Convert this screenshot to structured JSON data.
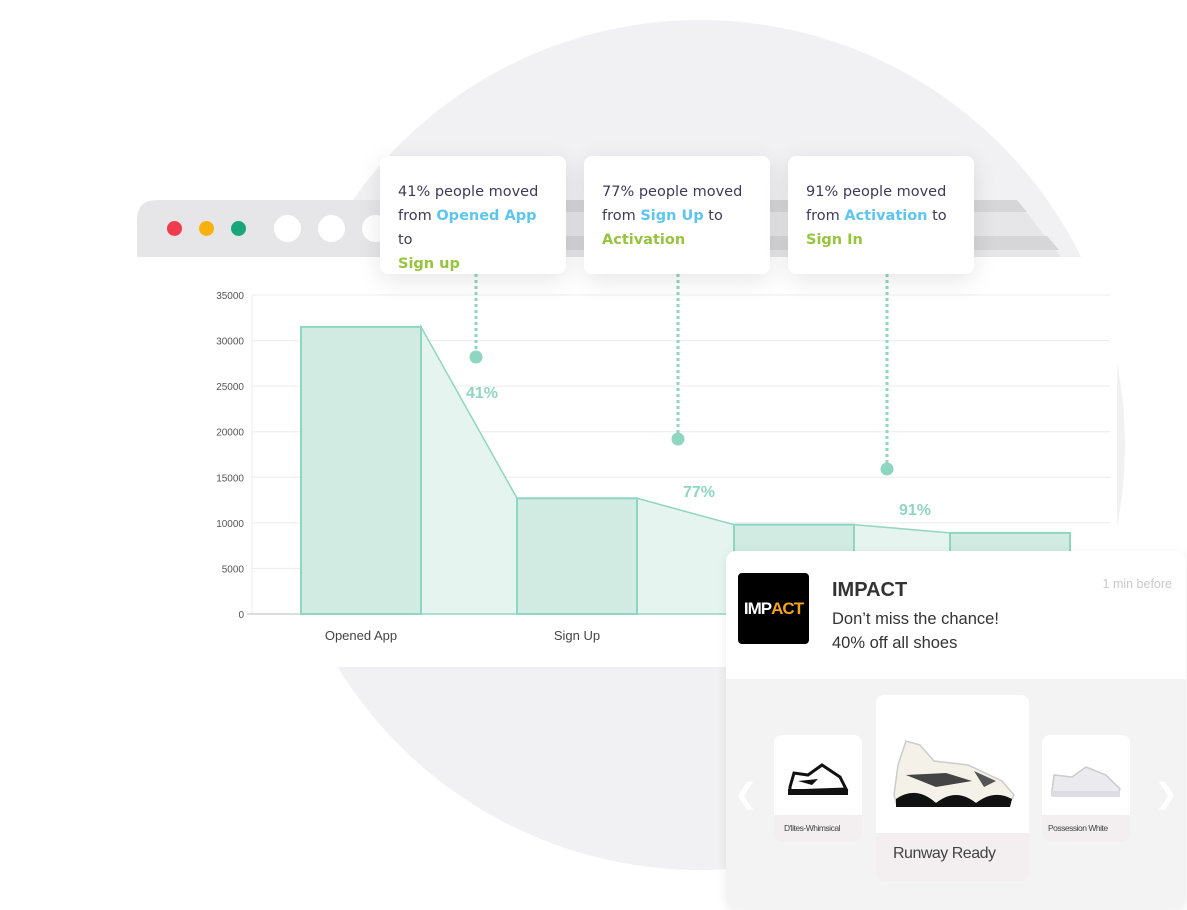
{
  "colors": {
    "accent": "#8fd6c0",
    "bar_fill": "#d1ebe3",
    "connector_fill": "#e6f4f0",
    "link_blue": "#5ec5ee",
    "link_green": "#97c33e",
    "traffic_red": "#ef3d4f",
    "traffic_yellow": "#f9b110",
    "traffic_green": "#1aa67b",
    "logo_orange": "#f6a21c"
  },
  "tooltips": [
    {
      "pre": "41% people moved",
      "from_word": "from",
      "from": "Opened App",
      "to_word": "to",
      "to": "Sign up"
    },
    {
      "pre": "77% people moved",
      "from_word": "from",
      "from": "Sign Up",
      "to_word": "to",
      "to": "Activation"
    },
    {
      "pre": "91% people moved",
      "from_word": "from",
      "from": "Activation",
      "to_word": "to",
      "to": "Sign In"
    }
  ],
  "chart_data": {
    "type": "bar",
    "subtype": "funnel",
    "categories": [
      "Opened App",
      "Sign Up",
      "Activation",
      "Sign In"
    ],
    "values": [
      31500,
      12700,
      9800,
      8900
    ],
    "conversion_labels": [
      "41%",
      "77%",
      "91%"
    ],
    "ylim": [
      0,
      35000
    ],
    "yticks": [
      "0",
      "5000",
      "10000",
      "15000",
      "20000",
      "25000",
      "30000",
      "35000"
    ],
    "grid": true
  },
  "notification": {
    "logo": "IMPACT",
    "brand": "IMPACT",
    "time": "1 min before",
    "line1": "Don’t miss the chance!",
    "line2": "40% off all shoes",
    "products": [
      {
        "name": "D'lites-Whimsical"
      },
      {
        "name": "Runway Ready"
      },
      {
        "name": "Possession White"
      }
    ],
    "prev_icon": "chevron-left-icon",
    "next_icon": "chevron-right-icon"
  }
}
